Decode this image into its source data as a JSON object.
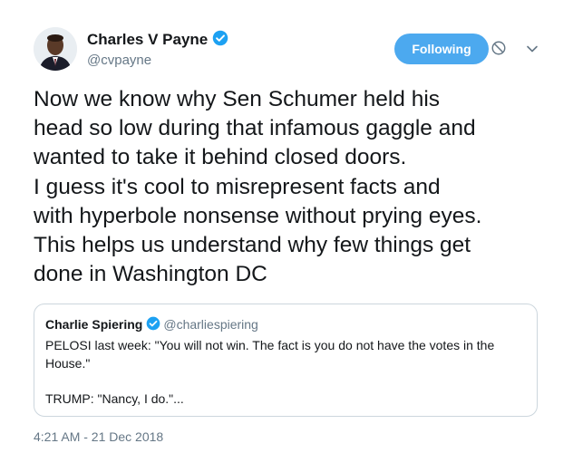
{
  "author": {
    "name": "Charles V Payne",
    "handle": "@cvpayne",
    "verified": true
  },
  "follow_button": {
    "label": "Following"
  },
  "tweet": {
    "text": "Now we know why Sen Schumer held his\nhead so low during that infamous gaggle and\nwanted to take it behind closed doors.\nI guess it's cool to misrepresent facts and\nwith hyperbole nonsense without prying eyes.\nThis helps us understand why few things get\ndone in Washington DC",
    "timestamp": "4:21 AM - 21 Dec 2018"
  },
  "quoted_tweet": {
    "name": "Charlie Spiering",
    "handle": "@charliespiering",
    "verified": true,
    "text": "PELOSI last week: \"You will not win. The fact is you do not have the votes in the\nHouse.\"\n\nTRUMP: \"Nancy, I do.\"..."
  },
  "colors": {
    "accent": "#4ca9ef",
    "verified": "#1da1f2",
    "muted_text": "#657786",
    "border": "#ccd6dd"
  },
  "icons": [
    "verified-badge-icon",
    "block-icon",
    "chevron-down-icon"
  ]
}
